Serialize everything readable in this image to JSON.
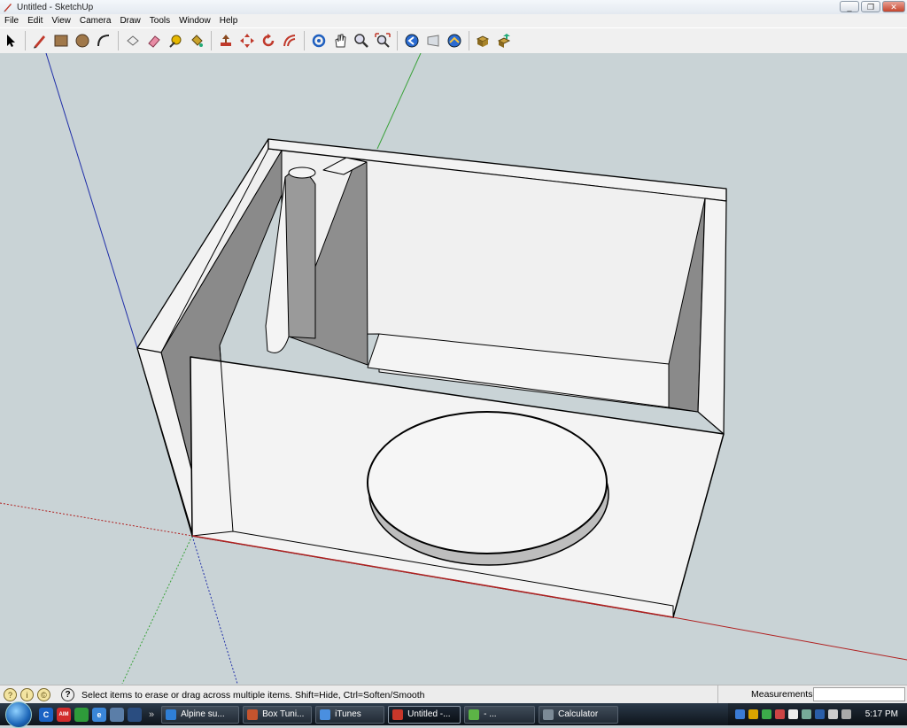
{
  "window": {
    "title": "Untitled - SketchUp",
    "controls": [
      "_",
      "❐",
      "✕"
    ]
  },
  "menu": [
    "File",
    "Edit",
    "View",
    "Camera",
    "Draw",
    "Tools",
    "Window",
    "Help"
  ],
  "toolbar": {
    "tools": [
      {
        "name": "select-tool-icon",
        "group": 1
      },
      {
        "name": "pencil-line-tool-icon",
        "group": 2
      },
      {
        "name": "rectangle-tool-icon",
        "group": 2
      },
      {
        "name": "circle-tool-icon",
        "group": 2
      },
      {
        "name": "arc-tool-icon",
        "group": 2
      },
      {
        "name": "make-component-icon",
        "group": 3
      },
      {
        "name": "eraser-tool-icon",
        "group": 3
      },
      {
        "name": "tape-measure-tool-icon",
        "group": 3
      },
      {
        "name": "paint-bucket-tool-icon",
        "group": 3
      },
      {
        "name": "push-pull-tool-icon",
        "group": 4
      },
      {
        "name": "move-tool-icon",
        "group": 4
      },
      {
        "name": "rotate-tool-icon",
        "group": 4
      },
      {
        "name": "offset-tool-icon",
        "group": 4
      },
      {
        "name": "orbit-tool-icon",
        "group": 5
      },
      {
        "name": "pan-tool-icon",
        "group": 5
      },
      {
        "name": "zoom-tool-icon",
        "group": 5
      },
      {
        "name": "zoom-extents-tool-icon",
        "group": 5
      },
      {
        "name": "previous-view-icon",
        "group": 6
      },
      {
        "name": "next-view-icon",
        "group": 6
      },
      {
        "name": "standard-views-icon",
        "group": 6
      },
      {
        "name": "get-models-icon",
        "group": 7
      },
      {
        "name": "share-model-icon",
        "group": 7
      }
    ]
  },
  "status": {
    "message": "Select items to erase or drag across multiple items. Shift=Hide, Ctrl=Soften/Smooth",
    "measurements_label": "Measurements",
    "measurements_value": ""
  },
  "taskbar": {
    "quicklaunch": [
      "C",
      "AIM",
      "",
      "e",
      "",
      ""
    ],
    "overflow": "»",
    "tasks": [
      {
        "label": "Alpine su...",
        "width": 88,
        "color": "#2f7fd6",
        "active": false
      },
      {
        "label": "Box Tuni...",
        "width": 78,
        "color": "#c4542e",
        "active": false
      },
      {
        "label": "iTunes",
        "width": 78,
        "color": "#4a8fe0",
        "active": false
      },
      {
        "label": "Untitled -...",
        "width": 82,
        "color": "#c8372a",
        "active": true
      },
      {
        "label": "- ...",
        "width": 80,
        "color": "#5cb446",
        "active": false
      },
      {
        "label": "Calculator",
        "width": 90,
        "color": "#7c8a96",
        "active": false
      }
    ],
    "clock": "5:17 PM"
  },
  "colors": {
    "viewport_bg": "#c9d3d6",
    "axis_blue": "#1f2ea8",
    "axis_green": "#3aa23a",
    "axis_red": "#b02020",
    "face_light": "#f2f2f2",
    "face_shadow": "#8a8a8a"
  }
}
